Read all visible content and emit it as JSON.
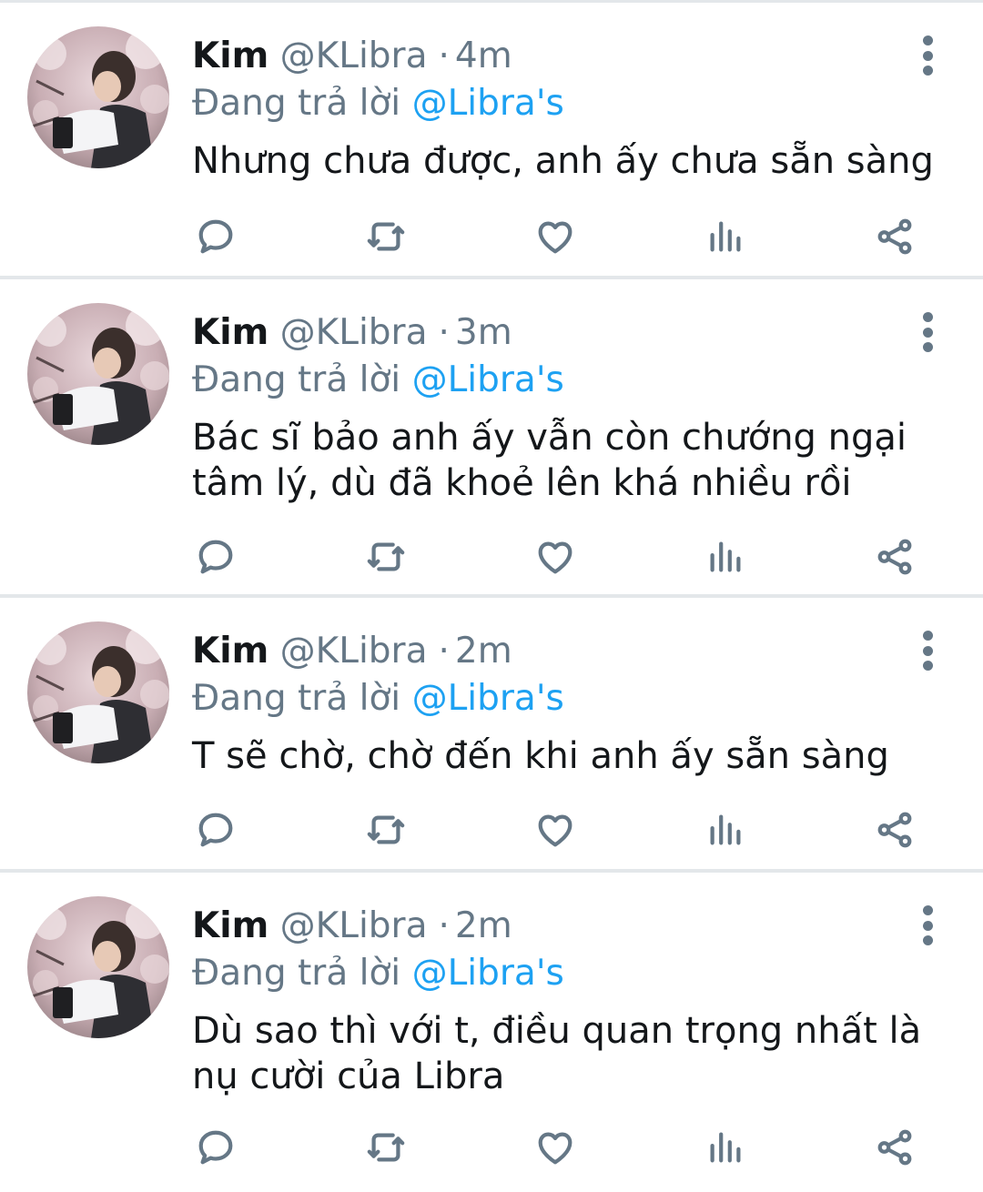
{
  "colors": {
    "text": "#14171a",
    "secondary": "#657786",
    "mention": "#1da1f2",
    "divider": "#e3e7ea"
  },
  "tweets": [
    {
      "name": "Kim",
      "handle": "@KLibra",
      "separator": "·",
      "time": "4m",
      "reply_prefix": "Đang trả lời",
      "reply_to": "@Libra's",
      "text": "Nhưng chưa được, anh ấy chưa sẵn sàng",
      "icons": [
        "reply-icon",
        "retweet-icon",
        "like-icon",
        "analytics-icon",
        "share-icon",
        "more-icon"
      ]
    },
    {
      "name": "Kim",
      "handle": "@KLibra",
      "separator": "·",
      "time": "3m",
      "reply_prefix": "Đang trả lời",
      "reply_to": "@Libra's",
      "text": "Bác sĩ bảo anh ấy vẫn còn chướng ngại tâm lý, dù đã khoẻ lên khá nhiều rồi",
      "icons": [
        "reply-icon",
        "retweet-icon",
        "like-icon",
        "analytics-icon",
        "share-icon",
        "more-icon"
      ]
    },
    {
      "name": "Kim",
      "handle": "@KLibra",
      "separator": "·",
      "time": "2m",
      "reply_prefix": "Đang trả lời",
      "reply_to": "@Libra's",
      "text": "T sẽ chờ, chờ đến khi anh ấy sẵn sàng",
      "icons": [
        "reply-icon",
        "retweet-icon",
        "like-icon",
        "analytics-icon",
        "share-icon",
        "more-icon"
      ]
    },
    {
      "name": "Kim",
      "handle": "@KLibra",
      "separator": "·",
      "time": "2m",
      "reply_prefix": "Đang trả lời",
      "reply_to": "@Libra's",
      "text": "Dù sao thì với t, điều quan trọng nhất là nụ cười của Libra",
      "icons": [
        "reply-icon",
        "retweet-icon",
        "like-icon",
        "analytics-icon",
        "share-icon",
        "more-icon"
      ]
    }
  ]
}
